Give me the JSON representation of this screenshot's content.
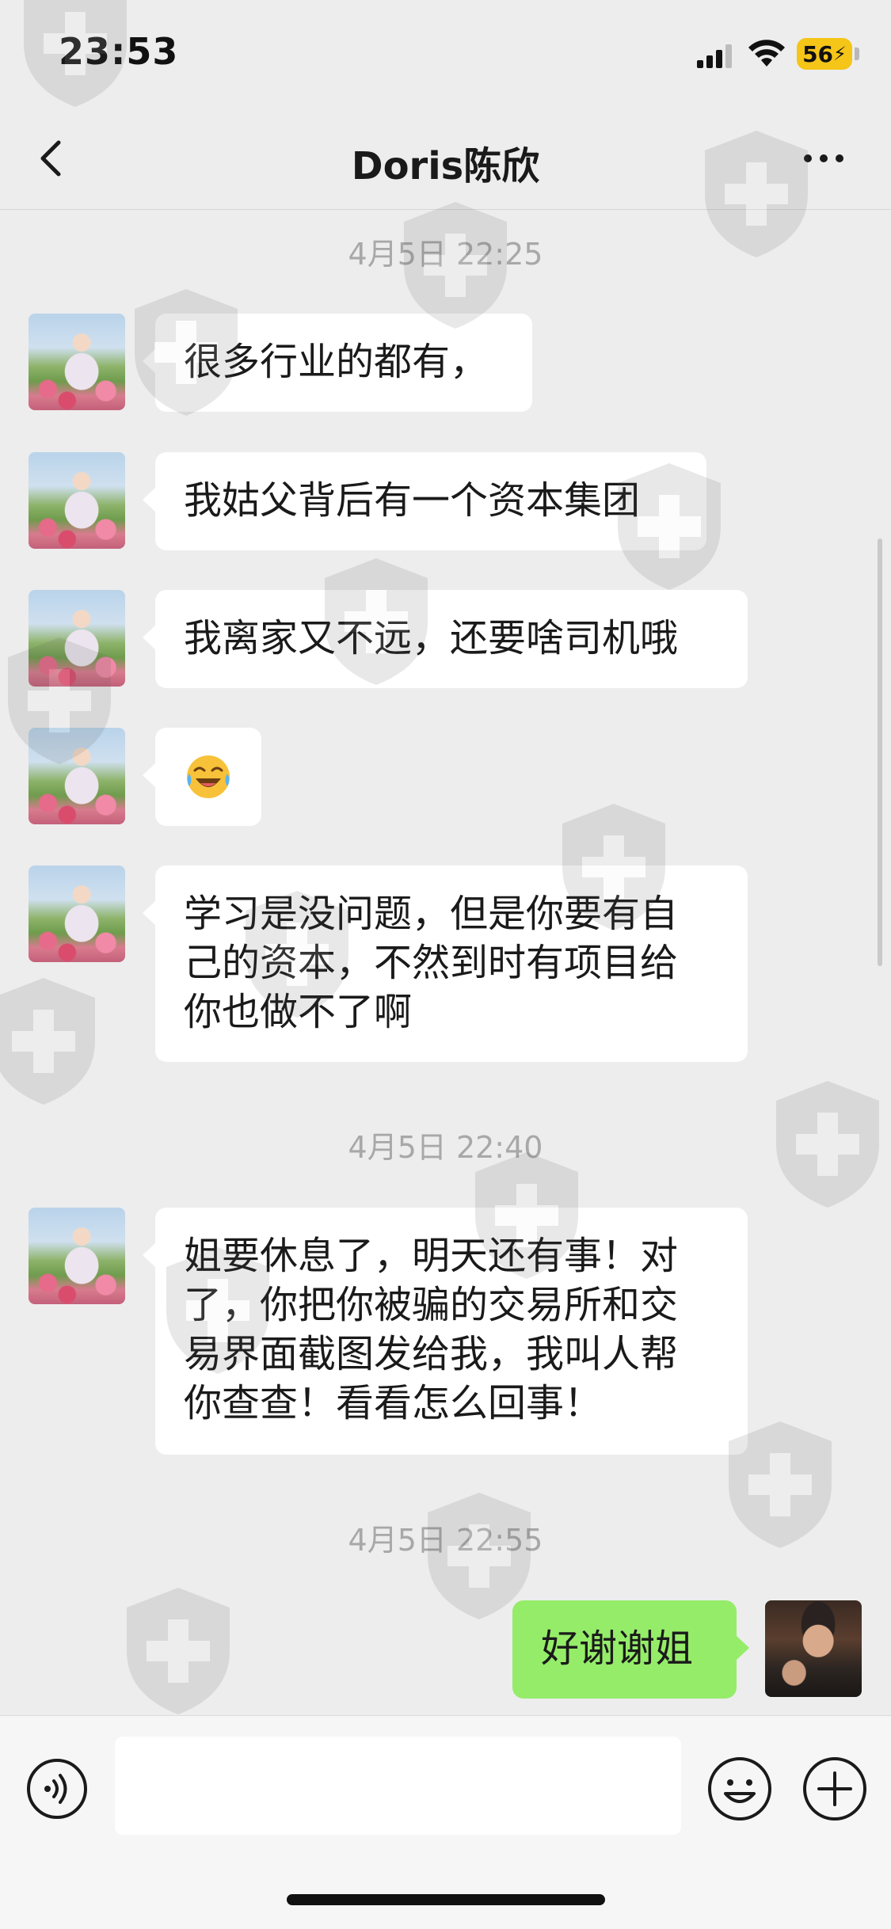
{
  "status_bar": {
    "time": "23:53",
    "battery": "56"
  },
  "nav": {
    "title": "Doris陈欣"
  },
  "messages": [
    {
      "kind": "time",
      "text": "4月5日 22:25"
    },
    {
      "kind": "in",
      "text": "很多行业的都有，"
    },
    {
      "kind": "in",
      "text": "我姑父背后有一个资本集团"
    },
    {
      "kind": "in",
      "text": "我离家又不远，还要啥司机哦"
    },
    {
      "kind": "in",
      "emoji": "crying-laughing-face"
    },
    {
      "kind": "in",
      "lines": [
        "学习是没问题，但是你要有自",
        "己的资本，不然到时有项目给",
        "你也做不了啊"
      ]
    },
    {
      "kind": "time",
      "text": "4月5日 22:40"
    },
    {
      "kind": "in",
      "lines": [
        "姐要休息了，明天还有事！对",
        "了，你把你被骗的交易所和交",
        "易界面截图发给我，我叫人帮",
        "你查查！看看怎么回事！"
      ]
    },
    {
      "kind": "time",
      "text": "4月5日 22:55"
    },
    {
      "kind": "out",
      "text": "好谢谢姐"
    }
  ],
  "input_bar": {
    "placeholder": ""
  },
  "icons": {
    "back": "chevron-left-icon",
    "more": "ellipsis-icon",
    "voice": "voice-icon",
    "emoji": "emoji-icon",
    "plus": "plus-icon"
  },
  "colors": {
    "background": "#ededed",
    "incoming_bubble": "#ffffff",
    "outgoing_bubble": "#95ec69",
    "timestamp": "#a8a8a8",
    "battery": "#f5c518"
  }
}
